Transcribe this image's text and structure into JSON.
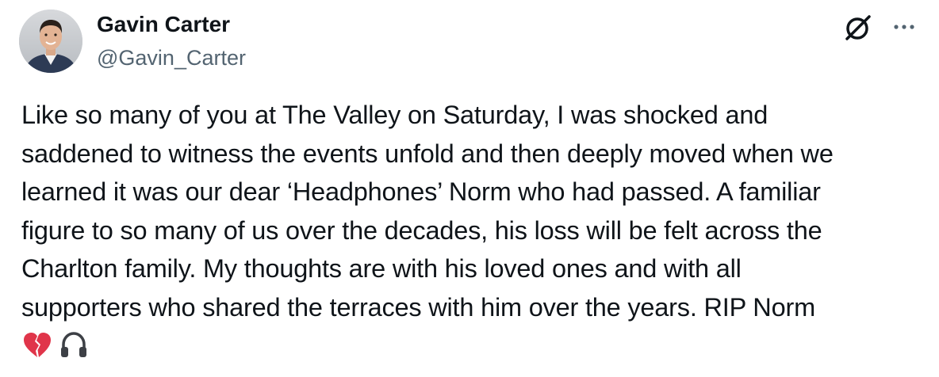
{
  "author": {
    "name": "Gavin Carter",
    "handle": "@Gavin_Carter"
  },
  "tweet": {
    "text": "Like so many of you at The Valley on Saturday, I was shocked and\nsaddened to witness the events unfold and then deeply moved when we\nlearned it was our dear ‘Headphones’ Norm who had passed. A familiar\nfigure to so many of us over the decades, his loss will be felt across the\nCharlton family. My thoughts are with his loved ones and with all\nsupporters who shared the terraces with him over the years. RIP Norm",
    "emojis": [
      "💔",
      "🎧"
    ]
  },
  "icons": {
    "grok": "grok-icon",
    "more": "more-options-icon",
    "broken_heart": "broken-heart-icon",
    "headphones": "headphones-icon"
  },
  "colors": {
    "text_primary": "#0f1419",
    "text_secondary": "#536471",
    "broken_heart": "#e0354a",
    "headphones": "#3d4046"
  }
}
